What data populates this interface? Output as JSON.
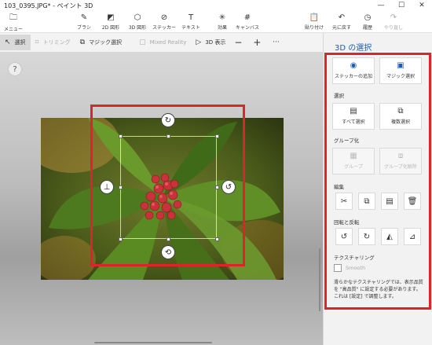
{
  "window": {
    "title": "103_0395.JPG* - ペイント 3D",
    "minimize": "—",
    "maximize": "☐",
    "close": "✕"
  },
  "ribbon": {
    "menu_label": "メニュー",
    "tools": [
      {
        "label": "ブラシ",
        "icon": "brush-icon"
      },
      {
        "label": "2D 図形",
        "icon": "2d-shapes-icon"
      },
      {
        "label": "3D 図形",
        "icon": "3d-shapes-icon"
      },
      {
        "label": "ステッカー",
        "icon": "stickers-icon"
      },
      {
        "label": "テキスト",
        "icon": "text-icon"
      },
      {
        "label": "効果",
        "icon": "effects-icon"
      },
      {
        "label": "キャンバス",
        "icon": "canvas-icon"
      }
    ],
    "actions": [
      {
        "label": "貼り付け",
        "icon": "paste-icon"
      },
      {
        "label": "元に戻す",
        "icon": "undo-icon"
      },
      {
        "label": "履歴",
        "icon": "history-icon"
      },
      {
        "label": "やり直し",
        "icon": "redo-icon"
      }
    ]
  },
  "toolbar": {
    "select": "選択",
    "crop": "トリミング",
    "magic_select": "マジック選択",
    "mixed_reality": "Mixed Reality",
    "view_3d": "3D 表示",
    "zoom_out": "−",
    "zoom_in": "+",
    "more": "···"
  },
  "canvas": {
    "help": "?"
  },
  "panel": {
    "title": "3D の選択",
    "add_sticker": "ステッカーの追加",
    "magic_select": "マジック選択",
    "select_section": "選択",
    "select_all": "すべて選択",
    "multi_select": "複数選択",
    "group_section": "グループ化",
    "group": "グループ",
    "ungroup": "グループ化解除",
    "edit_section": "編集",
    "rotate_section": "回転と反転",
    "texturing_section": "テクスチャリング",
    "smooth": "Smooth",
    "note": "滑らかなテクスチャリングでは、表示品質を \"高品質\" に設定する必要があります。これは [設定] で調整します。"
  },
  "colors": {
    "accent": "#1a5fb4",
    "highlight": "#e0222a"
  }
}
